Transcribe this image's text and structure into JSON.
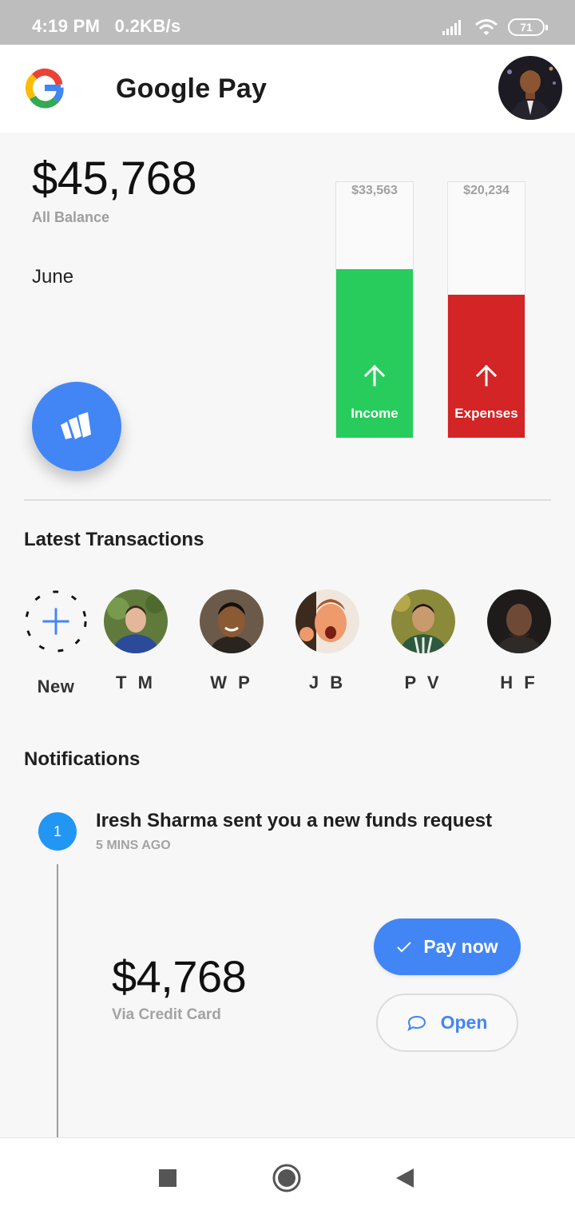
{
  "status_bar": {
    "time": "4:19 PM",
    "speed": "0.2KB/s",
    "battery": "71"
  },
  "app": {
    "title": "Google Pay"
  },
  "summary": {
    "balance": "$45,768",
    "balance_label": "All Balance",
    "month": "June",
    "income": {
      "amount": "$33,563",
      "label": "Income",
      "fill_fraction": 0.66,
      "color": "#27cc5d"
    },
    "expenses": {
      "amount": "$20,234",
      "label": "Expenses",
      "fill_fraction": 0.56,
      "color": "#d32426"
    }
  },
  "transactions": {
    "title": "Latest Transactions",
    "new_label": "New",
    "contacts": [
      {
        "initials": "T M",
        "icon": "person-avatar"
      },
      {
        "initials": "W P",
        "icon": "person-avatar"
      },
      {
        "initials": "J B",
        "icon": "person-avatar"
      },
      {
        "initials": "P V",
        "icon": "person-avatar"
      },
      {
        "initials": "H F",
        "icon": "person-avatar"
      }
    ]
  },
  "notifications": {
    "title": "Notifications",
    "items": [
      {
        "index": "1",
        "message": "Iresh Sharma sent you a new funds request",
        "time": "5 MINS AGO",
        "amount": "$4,768",
        "method": "Via Credit Card",
        "pay_label": "Pay now",
        "open_label": "Open"
      }
    ]
  },
  "colors": {
    "accent": "#4286f5",
    "timeline_dot": "#2196f3"
  }
}
